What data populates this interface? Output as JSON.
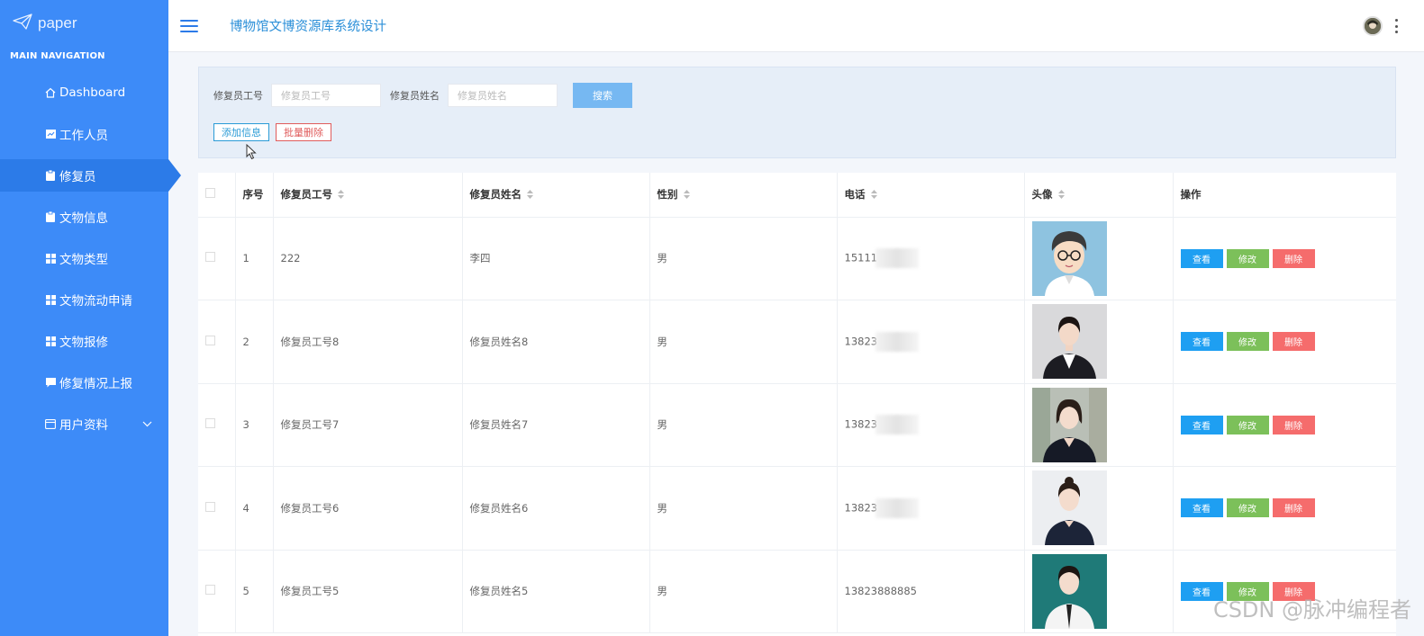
{
  "brand": {
    "name": "paper"
  },
  "sidebar": {
    "caption": "MAIN NAVIGATION",
    "items": [
      {
        "label": "Dashboard",
        "icon": "home-icon"
      },
      {
        "label": "工作人员",
        "icon": "chart-icon"
      },
      {
        "label": "修复员",
        "icon": "clipboard-icon",
        "active": true
      },
      {
        "label": "文物信息",
        "icon": "clipboard-icon"
      },
      {
        "label": "文物类型",
        "icon": "grid-icon"
      },
      {
        "label": "文物流动申请",
        "icon": "grid-icon"
      },
      {
        "label": "文物报修",
        "icon": "grid-icon"
      },
      {
        "label": "修复情况上报",
        "icon": "comment-icon"
      },
      {
        "label": "用户资料",
        "icon": "profile-icon"
      }
    ]
  },
  "header": {
    "title": "博物馆文博资源库系统设计"
  },
  "search": {
    "id_label": "修复员工号",
    "id_placeholder": "修复员工号",
    "name_label": "修复员姓名",
    "name_placeholder": "修复员姓名",
    "search_button": "搜索",
    "add_button": "添加信息",
    "bulk_delete_button": "批量删除"
  },
  "table": {
    "headers": [
      "序号",
      "修复员工号",
      "修复员姓名",
      "性别",
      "电话",
      "头像",
      "操作"
    ],
    "rows": [
      {
        "index": "1",
        "id": "222",
        "name": "李四",
        "gender": "男",
        "phone": "15111",
        "phone_masked": true
      },
      {
        "index": "2",
        "id": "修复员工号8",
        "name": "修复员姓名8",
        "gender": "男",
        "phone": "13823",
        "phone_masked": true
      },
      {
        "index": "3",
        "id": "修复员工号7",
        "name": "修复员姓名7",
        "gender": "男",
        "phone": "13823",
        "phone_masked": true
      },
      {
        "index": "4",
        "id": "修复员工号6",
        "name": "修复员姓名6",
        "gender": "男",
        "phone": "13823",
        "phone_masked": true
      },
      {
        "index": "5",
        "id": "修复员工号5",
        "name": "修复员姓名5",
        "gender": "男",
        "phone": "13823888885",
        "phone_masked": false
      }
    ],
    "view_label": "查看",
    "edit_label": "修改",
    "delete_label": "删除"
  },
  "colors": {
    "sidebar": "#3d8bf8",
    "active": "#2c7be8",
    "view": "#1e9ff2",
    "edit": "#7cc05a",
    "delete": "#f56c6c"
  },
  "watermark": "CSDN @脉冲编程者"
}
